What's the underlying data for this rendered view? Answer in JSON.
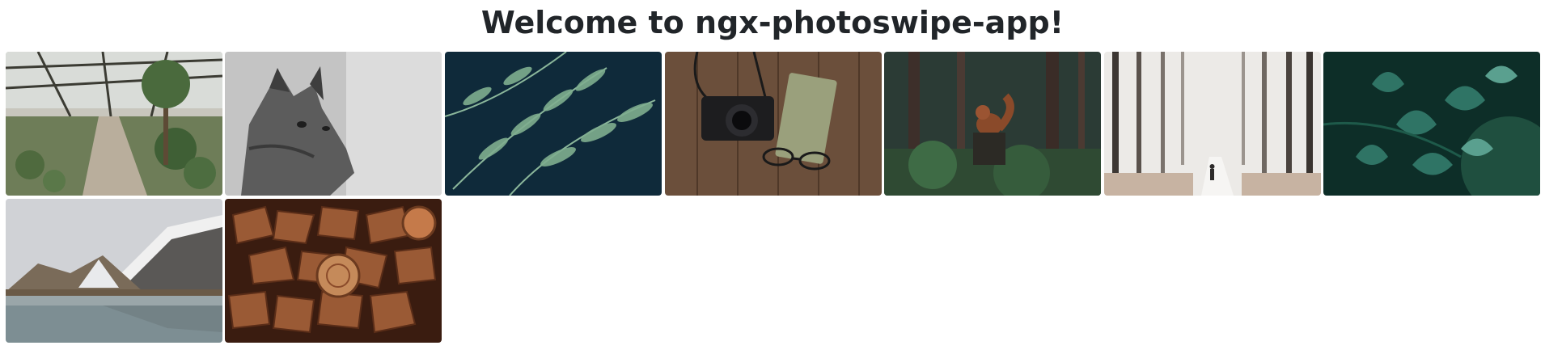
{
  "header": {
    "title": "Welcome to ngx-photoswipe-app!"
  },
  "gallery": {
    "photos": [
      {
        "subject": "greenhouse",
        "colors": [
          "#8a9a88",
          "#5e6f52",
          "#c9c1b3"
        ]
      },
      {
        "subject": "cat-grayscale",
        "colors": [
          "#bdbdbd",
          "#595959",
          "#e6e6e6"
        ]
      },
      {
        "subject": "fern-leaves",
        "colors": [
          "#0f2a3a",
          "#6f9a82",
          "#b6d1b2"
        ]
      },
      {
        "subject": "camera-on-wood",
        "colors": [
          "#6b4f3b",
          "#1d1d1f",
          "#9aa07c"
        ]
      },
      {
        "subject": "squirrel-forest",
        "colors": [
          "#2b3b35",
          "#8a4a2a",
          "#5f7c4f"
        ]
      },
      {
        "subject": "foggy-forest-walker",
        "colors": [
          "#e8e7e4",
          "#3d3733",
          "#b8b1ab"
        ]
      },
      {
        "subject": "green-leaves",
        "colors": [
          "#0d2e28",
          "#2f7465",
          "#5aa08f"
        ]
      },
      {
        "subject": "mountain-lake",
        "colors": [
          "#c9ccd1",
          "#4b4a49",
          "#7d8e93"
        ]
      },
      {
        "subject": "firewood-stack",
        "colors": [
          "#3a1c10",
          "#8b4b2a",
          "#c57a4a"
        ]
      }
    ]
  }
}
